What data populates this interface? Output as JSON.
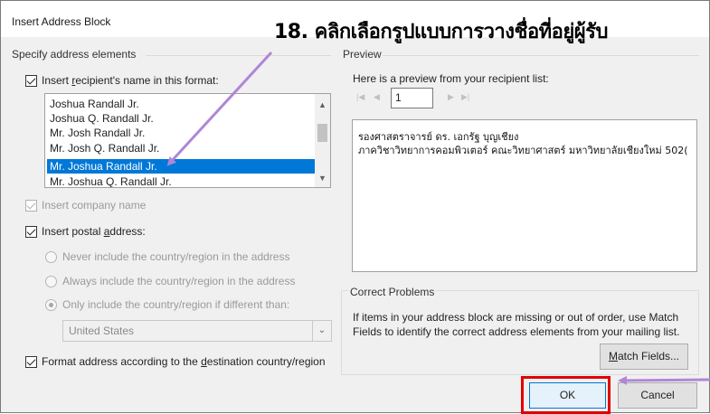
{
  "dialog": {
    "title": "Insert Address Block",
    "annotation": "18. คลิกเลือกรูปแบบการวางชื่อที่อยู่ผู้รับ"
  },
  "specify": {
    "heading": "Specify address elements",
    "recipient_name_label_pre": "Insert ",
    "recipient_name_label_u": "r",
    "recipient_name_label_post": "ecipient's name in this format:",
    "name_formats": [
      "Joshua Randall Jr.",
      "Joshua Q. Randall Jr.",
      "Mr. Josh Randall Jr.",
      "Mr. Josh Q. Randall Jr.",
      "Mr. Joshua Randall Jr.",
      "Mr. Joshua Q. Randall Jr."
    ],
    "selected_format": "Mr. Joshua Randall Jr.",
    "company_label": "Insert company name",
    "postal_label_pre": "Insert postal ",
    "postal_label_u": "a",
    "postal_label_post": "ddress:",
    "country_options": [
      "Never include the country/region in the address",
      "Always include the country/region in the address",
      "Only include the country/region if different than:"
    ],
    "country_value": "United States",
    "format_label_pre": "Format address according to the ",
    "format_label_u": "d",
    "format_label_post": "estination country/region"
  },
  "preview": {
    "heading": "Preview",
    "intro": "Here is a preview from your recipient list:",
    "record_number": "1",
    "lines": [
      "รองศาสตราจารย์ ดร. เอกรัฐ บุญเชียง",
      "ภาควิชาวิทยาการคอมพิวเตอร์ คณะวิทยาศาสตร์ มหาวิทยาลัยเชียงใหม่ 502("
    ]
  },
  "correct": {
    "heading": "Correct Problems",
    "text_line1": "If items in your address block are missing or out of order, use Match",
    "text_line2": "Fields to identify the correct address elements from your mailing list.",
    "match_pre": "",
    "match_u": "M",
    "match_post": "atch Fields..."
  },
  "buttons": {
    "ok": "OK",
    "cancel": "Cancel"
  },
  "colors": {
    "annotation_arrow": "#b086d6",
    "highlight_box": "#e00000",
    "selection": "#0078d7"
  }
}
